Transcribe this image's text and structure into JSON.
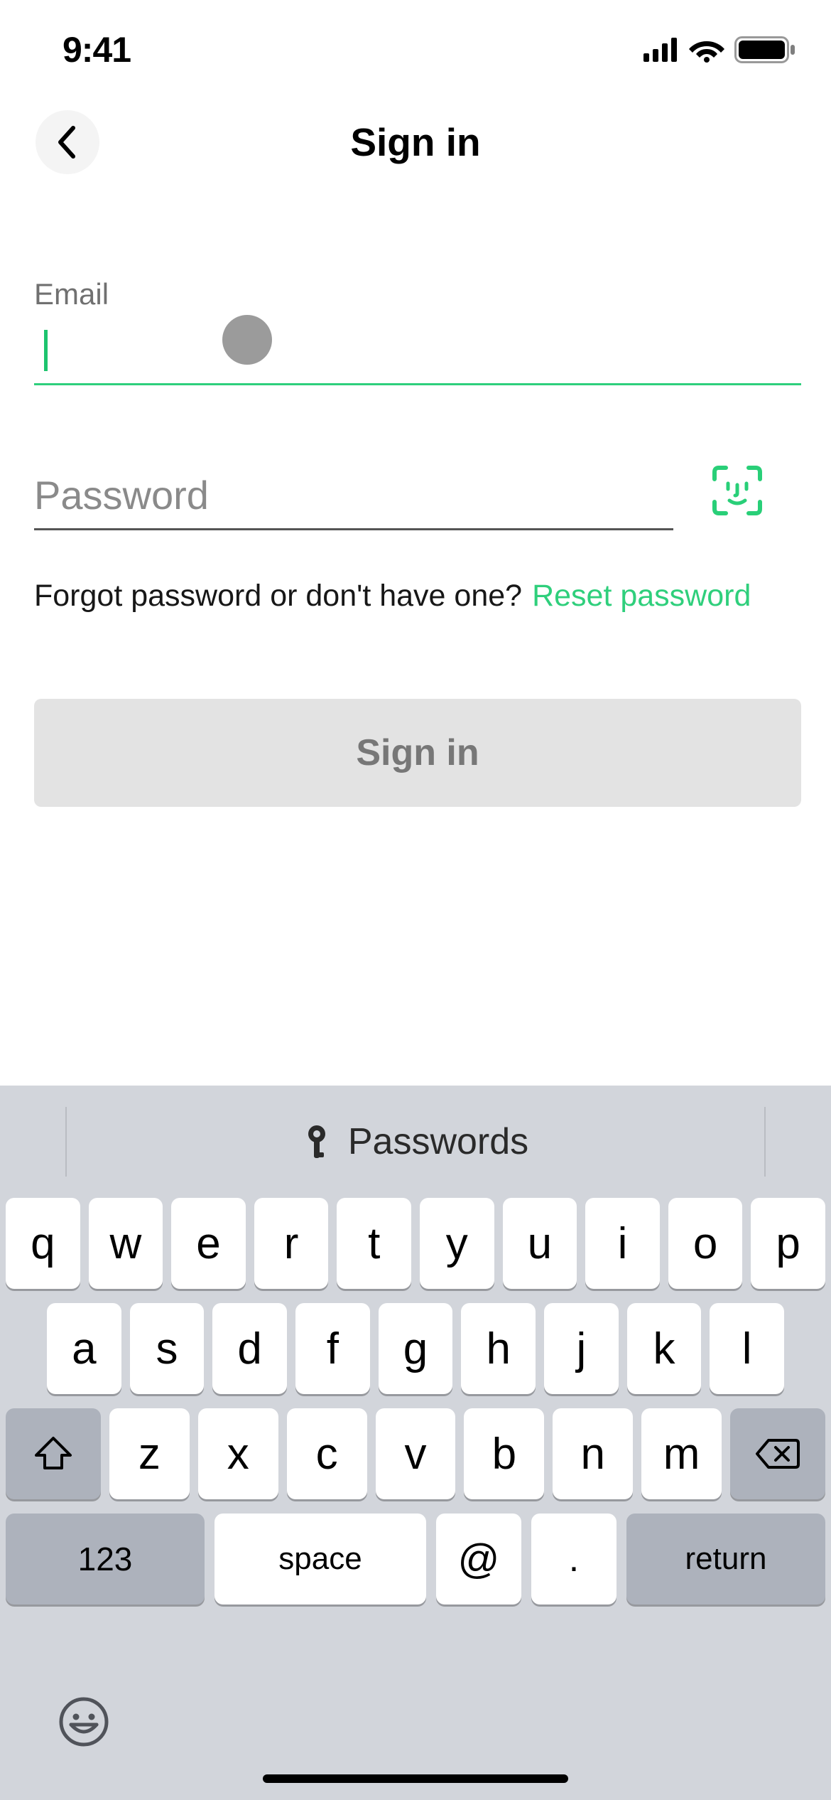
{
  "status": {
    "time": "9:41"
  },
  "header": {
    "title": "Sign in"
  },
  "form": {
    "email_label": "Email",
    "email_value": "",
    "password_placeholder": "Password",
    "password_value": "",
    "forgot_text": "Forgot password or don't have one?",
    "reset_link": "Reset password",
    "submit_label": "Sign in"
  },
  "keyboard": {
    "suggestion_label": "Passwords",
    "row1": [
      "q",
      "w",
      "e",
      "r",
      "t",
      "y",
      "u",
      "i",
      "o",
      "p"
    ],
    "row2": [
      "a",
      "s",
      "d",
      "f",
      "g",
      "h",
      "j",
      "k",
      "l"
    ],
    "row3": [
      "z",
      "x",
      "c",
      "v",
      "b",
      "n",
      "m"
    ],
    "num_key": "123",
    "space_key": "space",
    "at_key": "@",
    "dot_key": ".",
    "return_key": "return"
  },
  "colors": {
    "accent": "#2ecf7c"
  }
}
